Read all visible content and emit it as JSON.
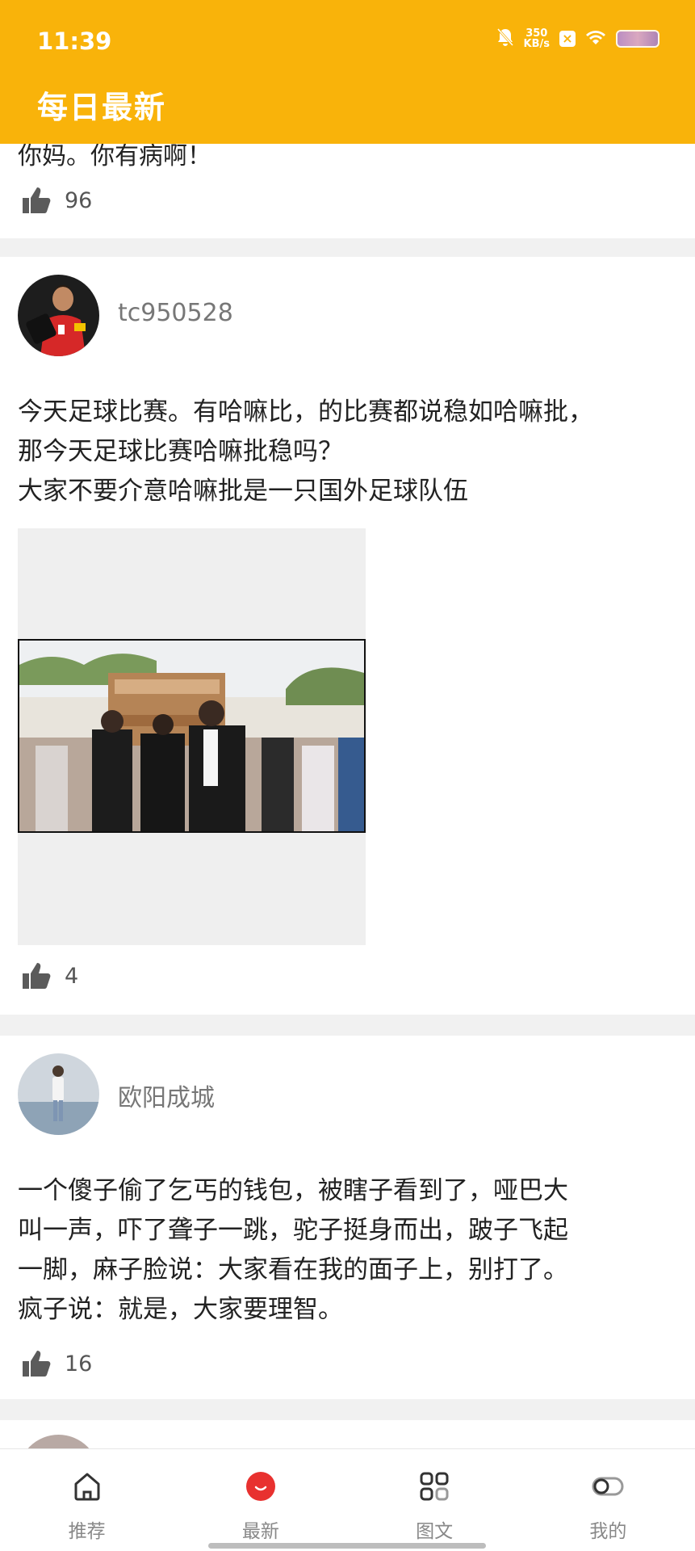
{
  "status_bar": {
    "time": "11:39",
    "speed_value": "350",
    "speed_unit": "KB/s",
    "icons": [
      "mute-bell-icon",
      "x-app-icon",
      "wifi-icon",
      "battery-icon"
    ]
  },
  "header": {
    "title": "每日最新"
  },
  "posts": [
    {
      "text": "你妈。你有病啊！",
      "likes": "96"
    },
    {
      "username": "tc950528",
      "text": "今天足球比赛。有哈嘛比，的比赛都说稳如哈嘛批，\n那今天足球比赛哈嘛批稳吗？\n大家不要介意哈嘛批是一只国外足球队伍",
      "likes": "4"
    },
    {
      "username": "欧阳成城",
      "text": "一个傻子偷了乞丐的钱包，被瞎子看到了，哑巴大\n叫一声，吓了聋子一跳，驼子挺身而出，跛子飞起\n一脚，麻子脸说：大家看在我的面子上，别打了。\n疯子说：就是，大家要理智。",
      "likes": "16"
    }
  ],
  "bottom_nav": [
    {
      "label": "推荐",
      "icon": "home-icon",
      "active": false
    },
    {
      "label": "最新",
      "icon": "latest-dot-icon",
      "active": true
    },
    {
      "label": "图文",
      "icon": "grid-icon",
      "active": false
    },
    {
      "label": "我的",
      "icon": "profile-toggle-icon",
      "active": false
    }
  ],
  "colors": {
    "header": "#f9b30a",
    "active_dot": "#e8312f"
  }
}
